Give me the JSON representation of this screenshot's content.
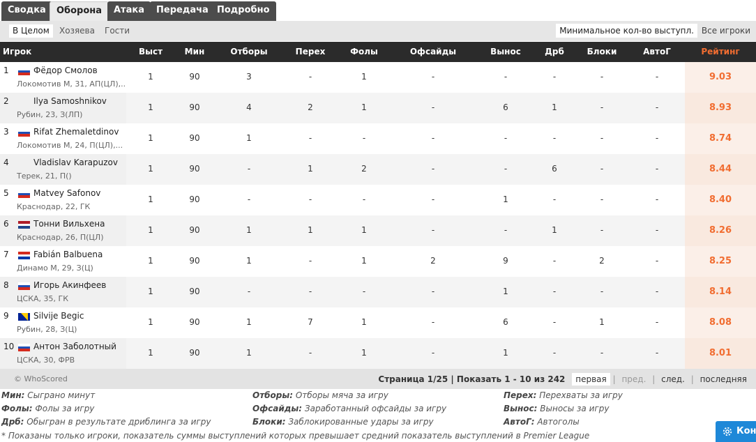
{
  "tabs": [
    "Сводка",
    "Оборона",
    "Атака",
    "Передача",
    "Подробно"
  ],
  "subfilters": [
    "В Целом",
    "Хозяева",
    "Гости"
  ],
  "min_apps_label": "Минимальное кол-во выступл.",
  "all_players_label": "Все игроки",
  "columns": [
    "Игрок",
    "Выст",
    "Мин",
    "Отборы",
    "Перех",
    "Фолы",
    "Офсайды",
    "Вынос",
    "Дрб",
    "Блоки",
    "АвтоГ",
    "Рейтинг"
  ],
  "rows": [
    {
      "rank": "1",
      "name": "Фёдор Смолов",
      "meta": "Локомотив М,  31, АП(ЦЛ),...",
      "flag": "ru",
      "cells": [
        "1",
        "90",
        "3",
        "-",
        "1",
        "-",
        "-",
        "-",
        "-",
        "-"
      ],
      "rating": "9.03"
    },
    {
      "rank": "2",
      "name": "Ilya Samoshnikov",
      "meta": "Рубин,  23, З(ЛП)",
      "flag": "",
      "cells": [
        "1",
        "90",
        "4",
        "2",
        "1",
        "-",
        "6",
        "1",
        "-",
        "-"
      ],
      "rating": "8.93"
    },
    {
      "rank": "3",
      "name": "Rifat Zhemaletdinov",
      "meta": "Локомотив М,  24, П(ЦЛ),...",
      "flag": "ru",
      "cells": [
        "1",
        "90",
        "1",
        "-",
        "-",
        "-",
        "-",
        "-",
        "-",
        "-"
      ],
      "rating": "8.74"
    },
    {
      "rank": "4",
      "name": "Vladislav Karapuzov",
      "meta": "Терек,  21, П()",
      "flag": "",
      "cells": [
        "1",
        "90",
        "-",
        "1",
        "2",
        "-",
        "-",
        "6",
        "-",
        "-"
      ],
      "rating": "8.44"
    },
    {
      "rank": "5",
      "name": "Matvey Safonov",
      "meta": "Краснодар,  22, ГК",
      "flag": "ru",
      "cells": [
        "1",
        "90",
        "-",
        "-",
        "-",
        "-",
        "1",
        "-",
        "-",
        "-"
      ],
      "rating": "8.40"
    },
    {
      "rank": "6",
      "name": "Тонни Вильхена",
      "meta": "Краснодар,  26, П(ЦЛ)",
      "flag": "nl",
      "cells": [
        "1",
        "90",
        "1",
        "1",
        "1",
        "-",
        "-",
        "1",
        "-",
        "-"
      ],
      "rating": "8.26"
    },
    {
      "rank": "7",
      "name": "Fabián Balbuena",
      "meta": "Динамо М,  29, З(Ц)",
      "flag": "py",
      "cells": [
        "1",
        "90",
        "1",
        "-",
        "1",
        "2",
        "9",
        "-",
        "2",
        "-"
      ],
      "rating": "8.25"
    },
    {
      "rank": "8",
      "name": "Игорь Акинфеев",
      "meta": "ЦСКА,  35, ГК",
      "flag": "ru",
      "cells": [
        "1",
        "90",
        "-",
        "-",
        "-",
        "-",
        "1",
        "-",
        "-",
        "-"
      ],
      "rating": "8.14"
    },
    {
      "rank": "9",
      "name": "Silvije Begic",
      "meta": "Рубин,  28, З(Ц)",
      "flag": "ba",
      "cells": [
        "1",
        "90",
        "1",
        "7",
        "1",
        "-",
        "6",
        "-",
        "1",
        "-"
      ],
      "rating": "8.08"
    },
    {
      "rank": "10",
      "name": "Антон Заболотный",
      "meta": "ЦСКА,  30, ФРВ",
      "flag": "ru",
      "cells": [
        "1",
        "90",
        "1",
        "-",
        "1",
        "-",
        "1",
        "-",
        "-",
        "-"
      ],
      "rating": "8.01"
    }
  ],
  "copyright": "© WhoScored",
  "pager": {
    "info": "Страница 1/25 | Показать 1 - 10 из 242",
    "first": "первая",
    "prev": "пред.",
    "next": "след.",
    "last": "последняя"
  },
  "legend": [
    {
      "key": "Мин:",
      "text": " Сыграно минут"
    },
    {
      "key": "Отборы:",
      "text": " Отборы мяча за игру"
    },
    {
      "key": "Перех:",
      "text": " Перехваты за игру"
    },
    {
      "key": "Фолы:",
      "text": " Фолы за игру"
    },
    {
      "key": "Офсайды:",
      "text": " Заработанный офсайды за игру"
    },
    {
      "key": "Вынос:",
      "text": " Выносы за игру"
    },
    {
      "key": "Дрб:",
      "text": " Обыгран в результате дриблинга за игру"
    },
    {
      "key": "Блоки:",
      "text": " Заблокированные удары за игру"
    },
    {
      "key": "АвтоГ:",
      "text": " Автоголы"
    }
  ],
  "note": "* Показаны только игроки, показатель суммы выступлений которых превышает средний показатель выступлений в Premier League",
  "config_button": "Кон",
  "colors": {
    "accent": "#f16d31",
    "header": "#2b2b2b",
    "config": "#1e88d8"
  }
}
